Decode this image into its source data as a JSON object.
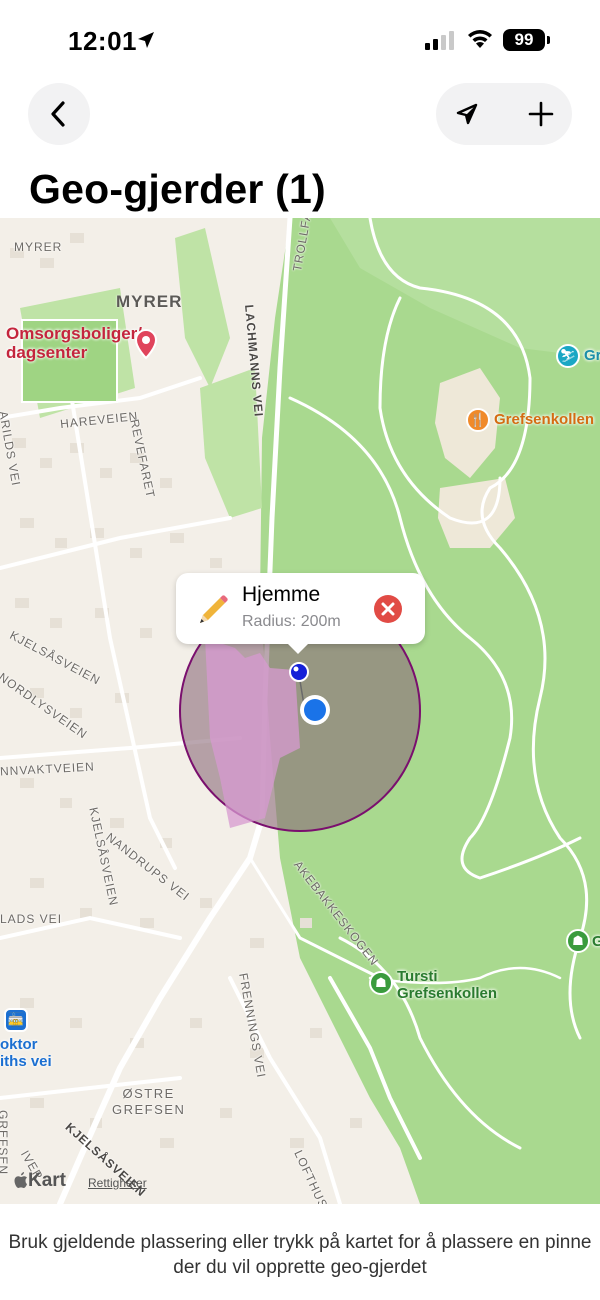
{
  "status_bar": {
    "time": "12:01",
    "battery": "99",
    "icons": [
      "location-arrow-icon",
      "signal-icon",
      "wifi-icon",
      "battery-icon"
    ]
  },
  "nav": {
    "back_icon": "chevron-left-icon",
    "locate_icon": "location-arrow-icon",
    "add_icon": "plus-icon"
  },
  "title": "Geo-gjerder (1)",
  "map": {
    "labels": {
      "myrer_small": "MYRER",
      "myrer_big": "MYRER",
      "trollfar": "TROLLFAR",
      "lachmanns_vei": "LACHMANNS VEI",
      "hareveien": "HAREVEIEN",
      "arilds_vei": "ARILDS VEI",
      "revefaret": "REVEFARET",
      "kjelsasveien_1": "KJELSÅSVEIEN",
      "nordlysveien": "NORDLYSVEIEN",
      "nnvaktveien": "NNVAKTVEIEN",
      "kjelsasveien_2": "KJELSÅSVEIEN",
      "nandrups_vei": "NANDRUPS VEI",
      "akebakkeskogen": "AKEBAKKESKOGEN",
      "lads_vei": "LADS VEI",
      "frennings_vei": "FRENNINGS VEI",
      "kjelsasveien_3": "KJELSÅSVEIEN",
      "lofthus": "LOFTHUS",
      "iver": "IVER",
      "grefsen_v": "GREFSEN"
    },
    "district": "ØSTRE\nGREFSEN",
    "pois": {
      "omsorgsboliger": "Omsorgsboliger/\ndagsenter",
      "grefsenkollen": "Grefsenkollen",
      "tursti": "Tursti\nGrefsenkollen",
      "gr_edge": "Gr",
      "g_edge": "G",
      "tram": "oktor\niths vei"
    },
    "attribution": "Kart",
    "legal": "Rettigheter",
    "colors": {
      "park": "#bfe3a6",
      "forest": "#a9d98f",
      "land": "#f3efe8",
      "geofence_fill": "#8c6a7a",
      "geofence_stroke": "#7a0f6e",
      "user_location": "#1a73e8",
      "pin": "#1420d8"
    }
  },
  "geofence": {
    "name": "Hjemme",
    "radius_label": "Radius: 200m",
    "edit_icon": "pencil-icon",
    "remove_icon": "remove-circle-icon"
  },
  "footer": {
    "instruction": "Bruk gjeldende plassering eller trykk på kartet for å plassere en pinne der du vil opprette geo-gjerdet"
  }
}
